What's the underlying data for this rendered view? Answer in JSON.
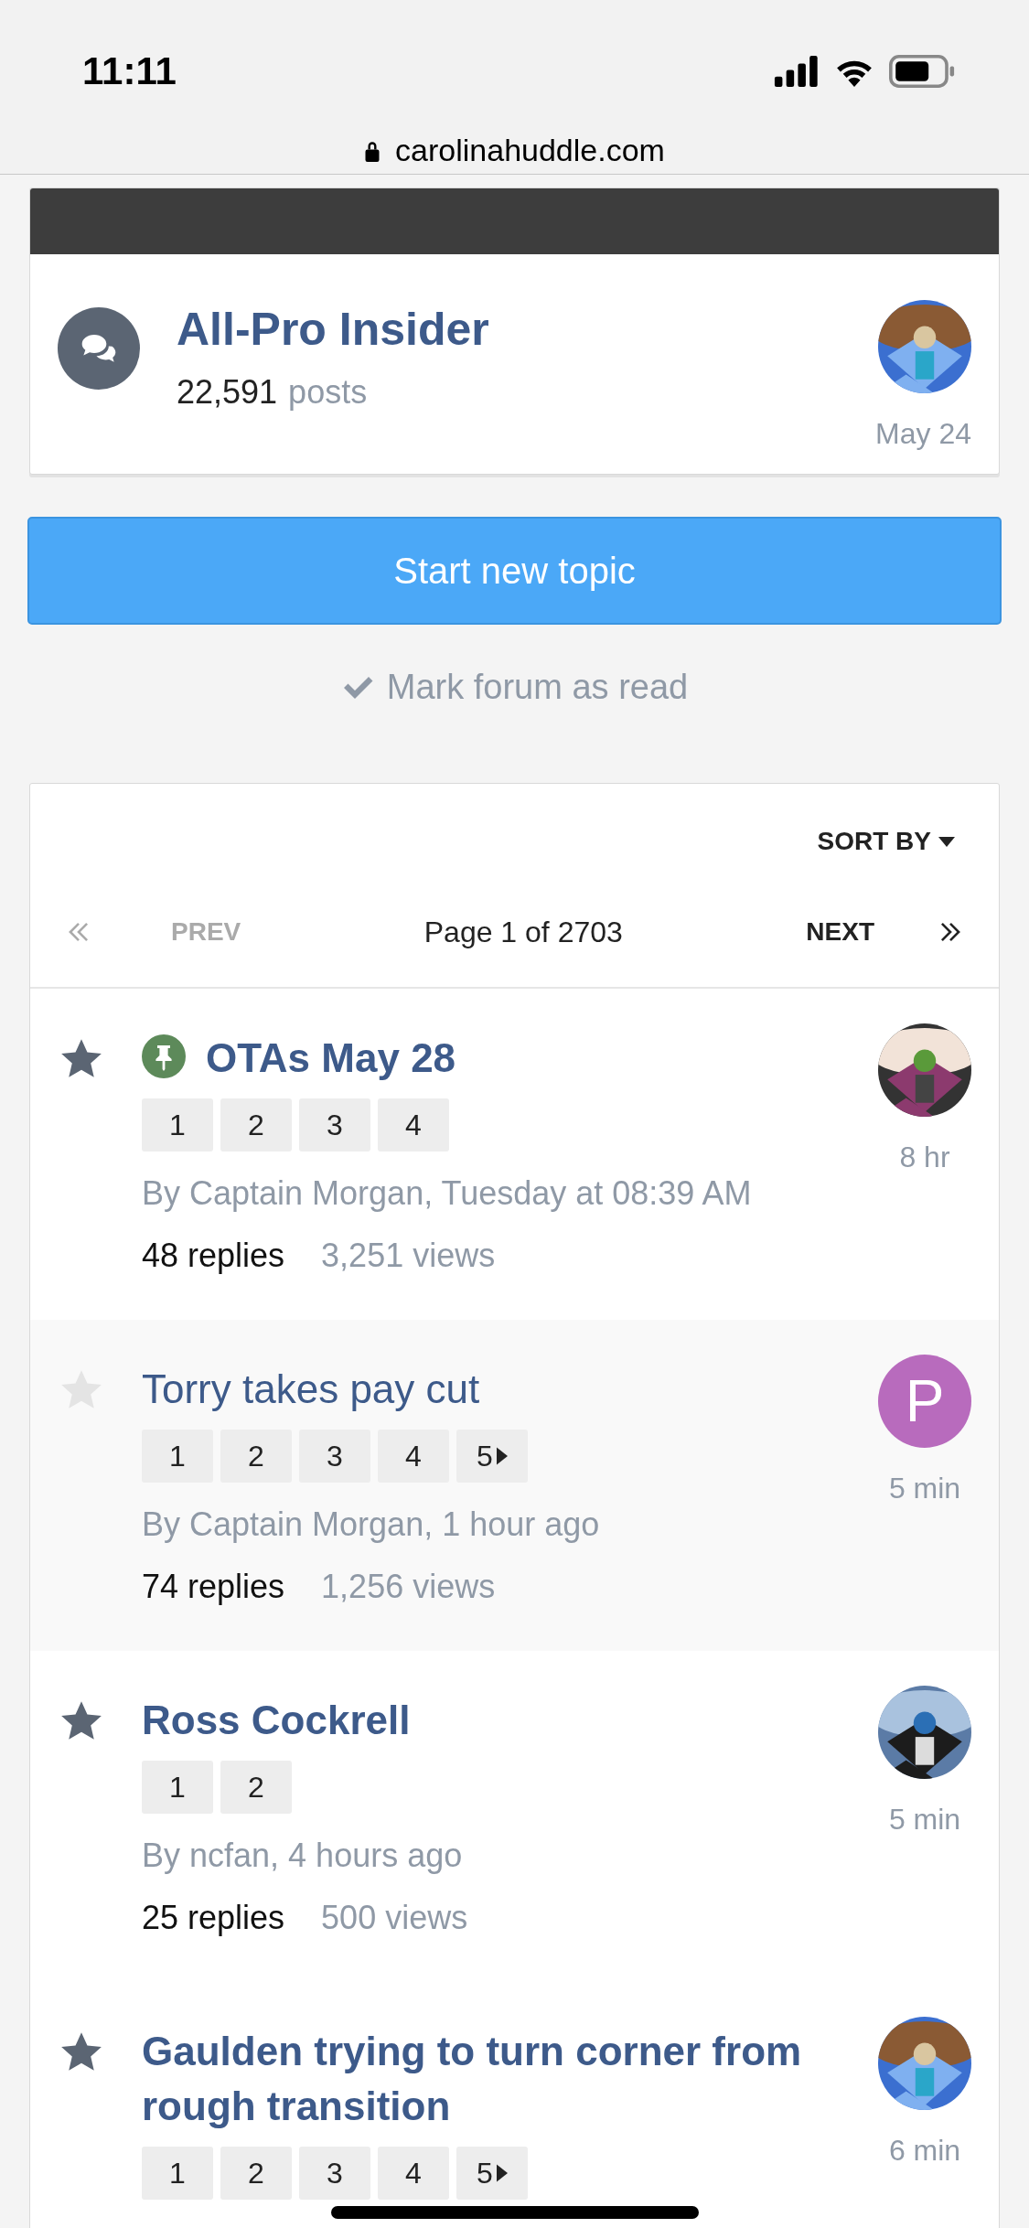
{
  "status_bar": {
    "time": "11:11"
  },
  "address_bar": {
    "url": "carolinahuddle.com"
  },
  "forum": {
    "title": "All-Pro Insider",
    "post_count": "22,591",
    "post_label": "posts",
    "last_post": "May 24",
    "avatar": {
      "kind": "picture"
    }
  },
  "start_button": "Start new topic",
  "mark_read": "Mark forum as read",
  "topic_list": {
    "sort_label": "SORT BY",
    "prev": "PREV",
    "next": "NEXT",
    "page_info": "Page 1 of 2703",
    "prev_disabled": true,
    "topics": [
      {
        "title": "OTAs May 28",
        "unread": true,
        "pinned": true,
        "pages": [
          "1",
          "2",
          "3",
          "4"
        ],
        "more_pages": false,
        "byline": "By Captain Morgan, Tuesday at 08:39 AM",
        "replies": "48 replies",
        "views": "3,251 views",
        "last": "8 hr",
        "avatar": {
          "kind": "picture"
        }
      },
      {
        "title": "Torry takes pay cut",
        "unread": false,
        "pinned": false,
        "pages": [
          "1",
          "2",
          "3",
          "4",
          "5"
        ],
        "more_pages": true,
        "byline": "By Captain Morgan, 1 hour ago",
        "replies": "74 replies",
        "views": "1,256 views",
        "last": "5 min",
        "avatar": {
          "kind": "letter",
          "letter": "P",
          "color": "#b86bbd"
        }
      },
      {
        "title": "Ross Cockrell",
        "unread": true,
        "pinned": false,
        "pages": [
          "1",
          "2"
        ],
        "more_pages": false,
        "byline": "By ncfan, 4 hours ago",
        "replies": "25 replies",
        "views": "500 views",
        "last": "5 min",
        "avatar": {
          "kind": "picture"
        }
      },
      {
        "title": "Gaulden trying to turn corner from rough transition",
        "unread": true,
        "pinned": false,
        "pages": [
          "1",
          "2",
          "3",
          "4",
          "5"
        ],
        "more_pages": true,
        "last": "6 min",
        "avatar": {
          "kind": "picture"
        }
      }
    ]
  }
}
